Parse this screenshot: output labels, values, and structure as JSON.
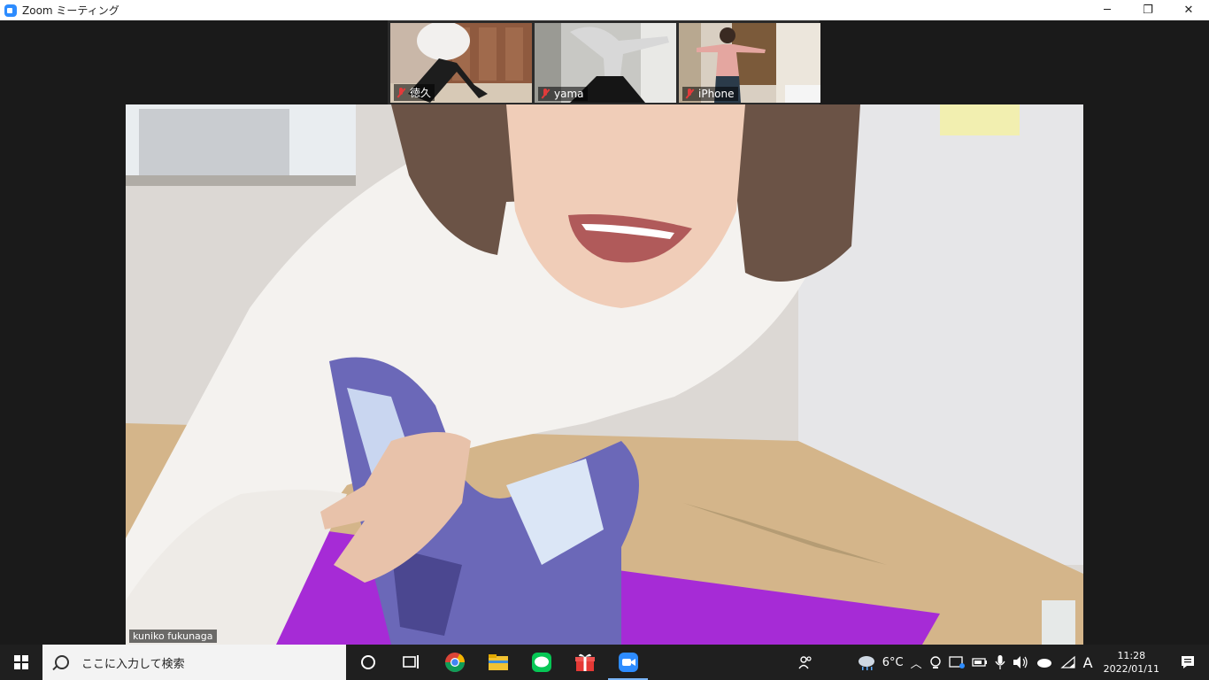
{
  "window": {
    "title": "Zoom ミーティング",
    "minimize": "─",
    "restore": "❐",
    "close": "✕"
  },
  "gallery": [
    {
      "name": "徳久",
      "muted": true
    },
    {
      "name": "yama",
      "muted": true
    },
    {
      "name": "iPhone",
      "muted": true
    }
  ],
  "speaker": {
    "name": "kuniko fukunaga"
  },
  "taskbar": {
    "search_placeholder": "ここに入力して検索",
    "weather": "6°C",
    "ime": "A",
    "time": "11:28",
    "date": "2022/01/11"
  },
  "colors": {
    "zoom_blue": "#2d8cff",
    "mat_purple": "#a62bd6"
  }
}
